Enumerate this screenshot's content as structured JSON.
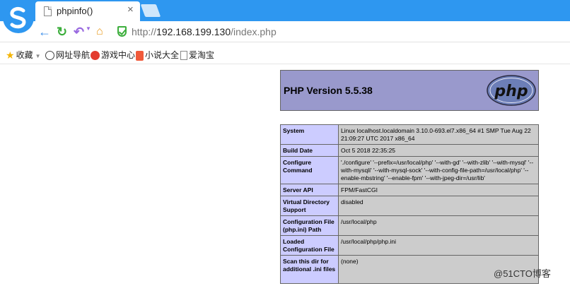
{
  "browser": {
    "tab": {
      "title": "phpinfo()",
      "close": "×"
    },
    "address": {
      "protocol": "http://",
      "host": "192.168.199.130",
      "path": "/index.php"
    },
    "bookmarks": [
      {
        "label": "收藏",
        "icon": "star-icon"
      },
      {
        "label": "网址导航",
        "icon": "globe-icon"
      },
      {
        "label": "游戏中心",
        "icon": "game-icon"
      },
      {
        "label": "小说大全",
        "icon": "book-icon"
      },
      {
        "label": "爱淘宝",
        "icon": "doc-icon"
      }
    ]
  },
  "phpinfo": {
    "version": "PHP Version 5.5.38",
    "logo_text": "php",
    "rows": [
      {
        "key": "System",
        "value": "Linux localhost.localdomain 3.10.0-693.el7.x86_64 #1 SMP Tue Aug 22 21:09:27 UTC 2017 x86_64"
      },
      {
        "key": "Build Date",
        "value": "Oct 5 2018 22:35:25"
      },
      {
        "key": "Configure Command",
        "value": "'./configure' '--prefix=/usr/local/php' '--with-gd' '--with-zlib' '--with-mysql' '--with-mysqli' '--with-mysql-sock' '--with-config-file-path=/usr/local/php' '--enable-mbstring' '--enable-fpm' '--with-jpeg-dir=/usr/lib'"
      },
      {
        "key": "Server API",
        "value": "FPM/FastCGI"
      },
      {
        "key": "Virtual Directory Support",
        "value": "disabled"
      },
      {
        "key": "Configuration File (php.ini) Path",
        "value": "/usr/local/php"
      },
      {
        "key": "Loaded Configuration File",
        "value": "/usr/local/php/php.ini"
      },
      {
        "key": "Scan this dir for additional .ini files",
        "value": "(none)"
      }
    ]
  },
  "watermark": "@51CTO博客",
  "colors": {
    "tabstrip": "#2e97f0",
    "php_header": "#9999cc",
    "key_cell": "#ccccff",
    "value_cell": "#cccccc"
  }
}
